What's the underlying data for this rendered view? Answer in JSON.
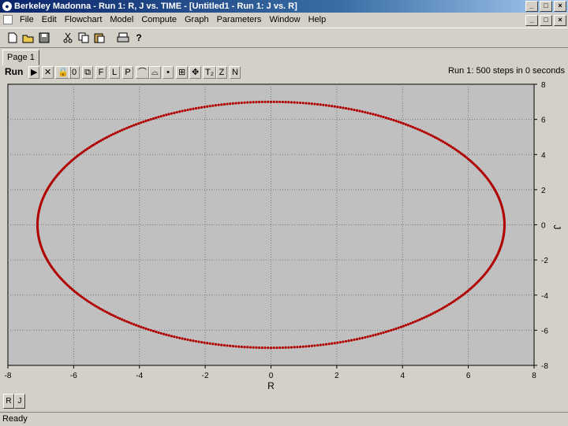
{
  "window": {
    "title": "Berkeley Madonna - Run 1: R, J vs. TIME - [Untitled1 - Run 1: J vs. R]",
    "controls": [
      "_",
      "□",
      "×"
    ]
  },
  "menu": {
    "items": [
      "File",
      "Edit",
      "Flowchart",
      "Model",
      "Compute",
      "Graph",
      "Parameters",
      "Window",
      "Help"
    ],
    "mdi_controls": [
      "_",
      "□",
      "×"
    ]
  },
  "toolbar": {
    "buttons": [
      "new-icon",
      "open-icon",
      "save-icon",
      "cut-icon",
      "copy-icon",
      "paste-icon",
      "print-icon",
      "help-icon"
    ]
  },
  "tabs": {
    "active": "Page 1"
  },
  "plot_toolbar": {
    "run_label": "Run",
    "buttons": [
      "▶",
      "✕",
      "🔒",
      "0",
      "⧉",
      "F",
      "L",
      "P",
      "⌒",
      "⌓",
      "•",
      "⊞",
      "✥",
      "T₂",
      "Z",
      "N"
    ],
    "run_info": "Run 1: 500 steps in 0 seconds"
  },
  "bottom_tabs": [
    "R",
    "J"
  ],
  "status": {
    "text": "Ready"
  },
  "chart_data": {
    "type": "scatter",
    "xlabel": "R",
    "ylabel": "J",
    "xlim": [
      -8,
      8
    ],
    "ylim": [
      -8,
      8
    ],
    "xticks": [
      "-8",
      "-6",
      "-4",
      "-2",
      "0",
      "2",
      "4",
      "6",
      "8"
    ],
    "yticks": [
      "8",
      "6",
      "4",
      "2",
      "0",
      "-2",
      "-4",
      "-6",
      "-8"
    ],
    "grid": true,
    "y_axis_position": "right",
    "series": [
      {
        "shape": "ellipse",
        "center": [
          0,
          0
        ],
        "radius_x": 7.1,
        "radius_y": 7.0,
        "points": 500,
        "color": "#b00000"
      }
    ],
    "background": "#c0c0c0"
  }
}
